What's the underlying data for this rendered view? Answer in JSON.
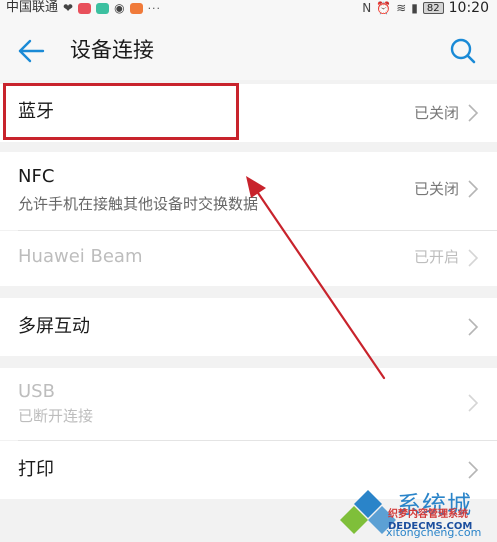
{
  "status_bar": {
    "carrier": "中国联通",
    "dots": "···",
    "battery": "82",
    "time": "10:20"
  },
  "header": {
    "title": "设备连接"
  },
  "rows": [
    {
      "label": "蓝牙",
      "value": "已关闭"
    },
    {
      "label": "NFC",
      "subtitle": "允许手机在接触其他设备时交换数据",
      "value": "已关闭"
    },
    {
      "label": "Huawei Beam",
      "value": "已开启"
    },
    {
      "label": "多屏互动"
    },
    {
      "label": "USB",
      "subtitle": "已断开连接"
    },
    {
      "label": "打印"
    }
  ],
  "watermark": {
    "brand": "系统城",
    "cms_line1": "织梦内容管理系统",
    "cms_line2": "DEDECMS.COM",
    "site": "xitongcheng.com"
  },
  "colors": {
    "accent": "#1a8ad6",
    "highlight": "#c8232c",
    "background": "#f2f2f2"
  }
}
